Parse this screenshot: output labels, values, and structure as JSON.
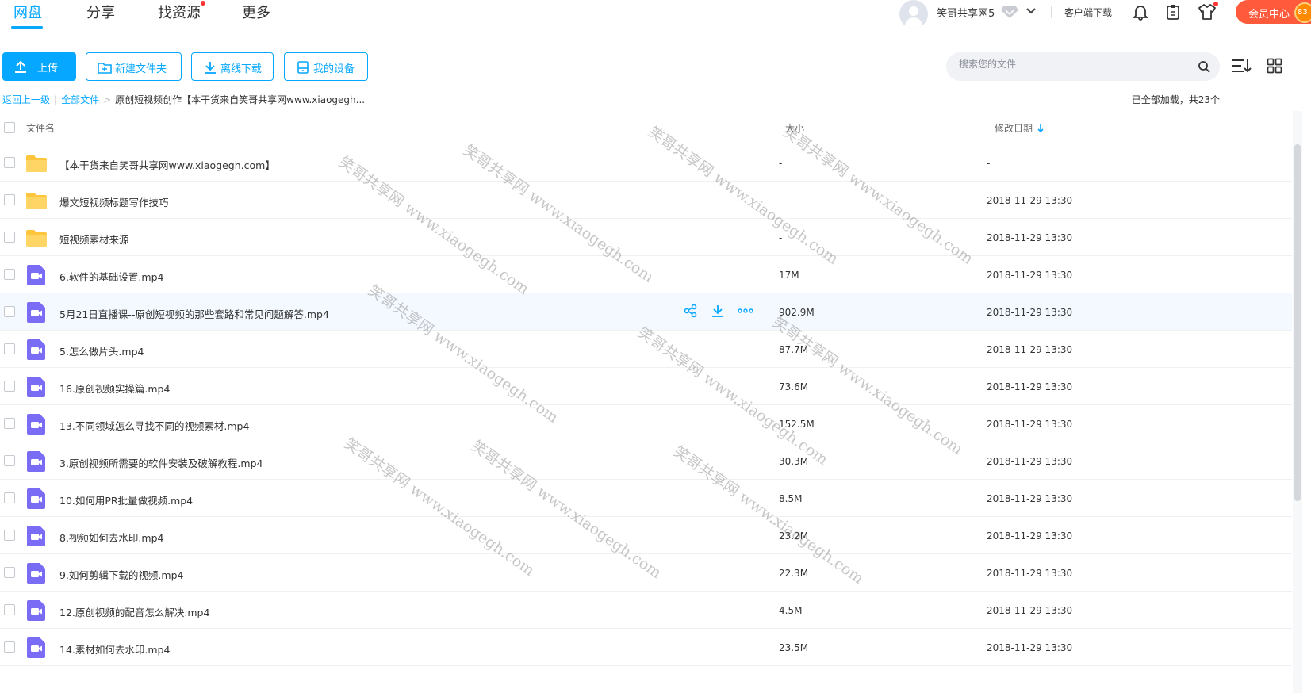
{
  "nav": {
    "tabs": [
      "网盘",
      "分享",
      "找资源",
      "更多"
    ],
    "username": "笑哥共享网5",
    "client_download": "客户端下载",
    "vip_center": "会员中心",
    "coin_badge": "83"
  },
  "toolbar": {
    "upload": "上传",
    "new_folder": "新建文件夹",
    "offline_download": "离线下载",
    "my_devices": "我的设备",
    "search_placeholder": "搜索您的文件"
  },
  "breadcrumb": {
    "back": "返回上一级",
    "all_files": "全部文件",
    "current": "原创短视频创作【本干货来自笑哥共享网www.xiaogegh...",
    "sep": ">"
  },
  "status": "已全部加载，共23个",
  "table": {
    "headers": {
      "name": "文件名",
      "size": "大小",
      "date": "修改日期"
    },
    "rows": [
      {
        "name": "【本干货来自笑哥共享网www.xiaogegh.com】",
        "size": "-",
        "date": "-",
        "type": "folder"
      },
      {
        "name": "爆文短视频标题写作技巧",
        "size": "-",
        "date": "2018-11-29 13:30",
        "type": "folder"
      },
      {
        "name": "短视频素材来源",
        "size": "-",
        "date": "2018-11-29 13:30",
        "type": "folder"
      },
      {
        "name": "6.软件的基础设置.mp4",
        "size": "17M",
        "date": "2018-11-29 13:30",
        "type": "video"
      },
      {
        "name": "5月21日直播课--原创短视频的那些套路和常见问题解答.mp4",
        "size": "902.9M",
        "date": "2018-11-29 13:30",
        "type": "video",
        "hover": true
      },
      {
        "name": "5.怎么做片头.mp4",
        "size": "87.7M",
        "date": "2018-11-29 13:30",
        "type": "video"
      },
      {
        "name": "16.原创视频实操篇.mp4",
        "size": "73.6M",
        "date": "2018-11-29 13:30",
        "type": "video"
      },
      {
        "name": "13.不同领域怎么寻找不同的视频素材.mp4",
        "size": "152.5M",
        "date": "2018-11-29 13:30",
        "type": "video"
      },
      {
        "name": "3.原创视频所需要的软件安装及破解教程.mp4",
        "size": "30.3M",
        "date": "2018-11-29 13:30",
        "type": "video"
      },
      {
        "name": "10.如何用PR批量做视频.mp4",
        "size": "8.5M",
        "date": "2018-11-29 13:30",
        "type": "video"
      },
      {
        "name": "8.视频如何去水印.mp4",
        "size": "23.2M",
        "date": "2018-11-29 13:30",
        "type": "video"
      },
      {
        "name": "9.如何剪辑下载的视频.mp4",
        "size": "22.3M",
        "date": "2018-11-29 13:30",
        "type": "video"
      },
      {
        "name": "12.原创视频的配音怎么解决.mp4",
        "size": "4.5M",
        "date": "2018-11-29 13:30",
        "type": "video"
      },
      {
        "name": "14.素材如何去水印.mp4",
        "size": "23.5M",
        "date": "2018-11-29 13:30",
        "type": "video"
      }
    ]
  },
  "watermark": "笑哥共享网 www.xiaogegh.com",
  "colors": {
    "accent": "#06a7ff",
    "folder": "#ffc53d",
    "video": "#7b6cf6",
    "vip": "#ff5a3c",
    "hover_row": "#f4f9ff"
  },
  "icons": [
    "upload-icon",
    "new-folder-icon",
    "download-icon",
    "device-icon",
    "search-icon",
    "sort-icon",
    "grid-view-icon",
    "bell-icon",
    "clipboard-icon",
    "tshirt-icon",
    "share-icon",
    "more-icon",
    "folder-icon",
    "video-file-icon"
  ]
}
